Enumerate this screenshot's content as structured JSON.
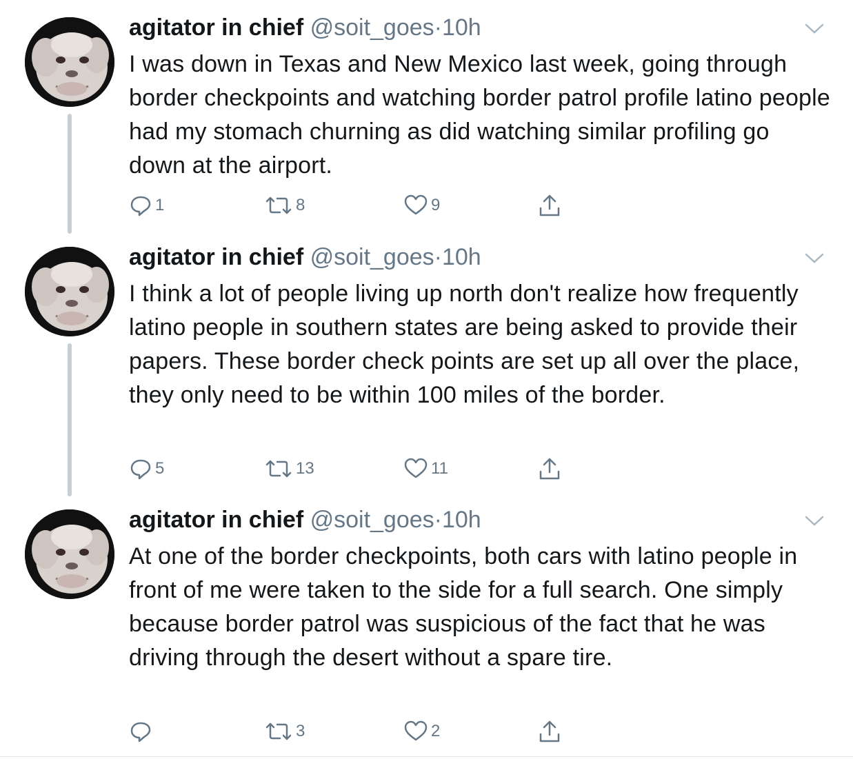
{
  "tweets": [
    {
      "author": {
        "name": "agitator in chief",
        "handle": "@soit_goes",
        "avatar": "falkor-luckdragon-avatar"
      },
      "separator": "·",
      "time": "10h",
      "text": "I was down in Texas and New Mexico last week, going through border checkpoints and watching border patrol profile latino people had my stomach churning as did watching similar profiling go down at the airport.",
      "replies": "1",
      "retweets": "8",
      "likes": "9"
    },
    {
      "author": {
        "name": "agitator in chief",
        "handle": "@soit_goes",
        "avatar": "falkor-luckdragon-avatar"
      },
      "separator": "·",
      "time": "10h",
      "text": "I think a lot of people living up north don't realize how frequently latino people in southern states are being asked to provide their papers. These border check points are set up all over the place, they only need to be within 100 miles of the border.",
      "replies": "5",
      "retweets": "13",
      "likes": "11"
    },
    {
      "author": {
        "name": "agitator in chief",
        "handle": "@soit_goes",
        "avatar": "falkor-luckdragon-avatar"
      },
      "separator": "·",
      "time": "10h",
      "text": "At one of the border checkpoints, both cars with latino people in front of me were taken to the side for a full search. One simply because border patrol was suspicious of the fact that he was driving through the desert without a spare tire.",
      "replies": "",
      "retweets": "3",
      "likes": "2"
    }
  ],
  "icons": {
    "reply": "reply-icon",
    "retweet": "retweet-icon",
    "like": "heart-icon",
    "share": "share-icon",
    "menu": "chevron-down-icon"
  },
  "colors": {
    "text": "#14171a",
    "secondary": "#657786",
    "thread_line": "#c4cfd6"
  }
}
